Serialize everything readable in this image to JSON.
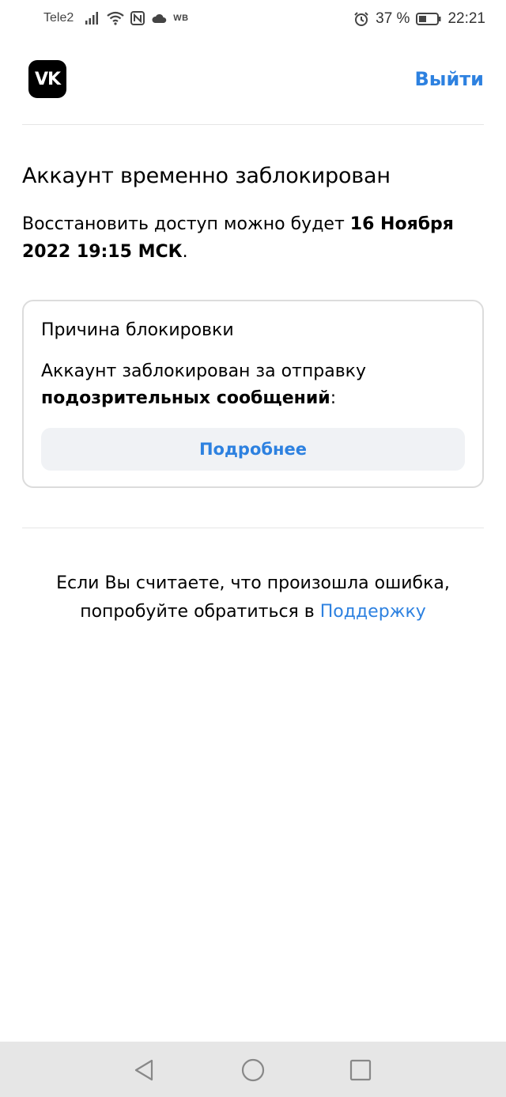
{
  "status_bar": {
    "carrier": "Tele2",
    "wb": "WB",
    "battery": "37 %",
    "time": "22:21"
  },
  "header": {
    "logo": "VK",
    "logout_label": "Выйти"
  },
  "main": {
    "title": "Аккаунт временно заблокирован",
    "subtitle_prefix": "Восстановить доступ можно будет ",
    "subtitle_date": "16 Ноября 2022 19:15 МСК",
    "subtitle_suffix": "."
  },
  "reason_card": {
    "title": "Причина блокировки",
    "text_prefix": "Аккаунт заблокирован за отправку ",
    "text_bold": "подозрительных сообщений",
    "text_suffix": ":",
    "more_label": "Подробнее"
  },
  "support": {
    "text_prefix": "Если Вы считаете, что произошла ошибка, попробуйте обратиться в ",
    "link_label": "Поддержку"
  },
  "nav_bar": {
    "icons": [
      "back-icon",
      "home-icon",
      "recents-icon"
    ]
  },
  "colors": {
    "accent": "#2d81e0",
    "button_bg": "#f0f2f5",
    "nav_bg": "#e6e6e6"
  }
}
